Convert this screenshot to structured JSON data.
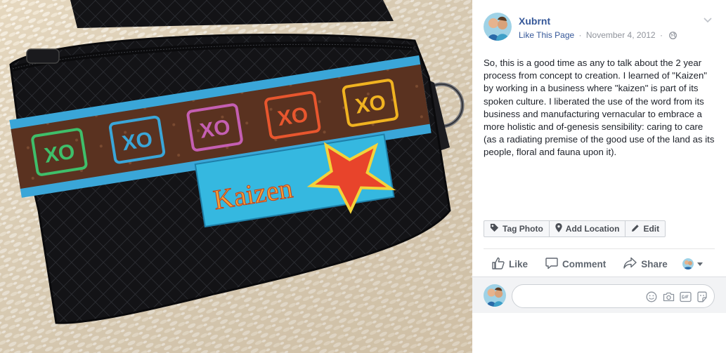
{
  "photo": {
    "label_text": "Kaizen",
    "logo_text": "XO",
    "alt": "Black wallet with embroidered ribbon and Kaizen label on rice"
  },
  "post": {
    "page_name": "Xubrnt",
    "like_page_label": "Like This Page",
    "separator": "·",
    "date": "November 4, 2012",
    "text": "So, this is a good time as any to talk about the 2 year process from concept to creation. I learned of \"Kaizen\" by working in a business where \"kaizen\" is part of its spoken culture. I liberated the use of the word from its business and manufacturing vernacular to embrace a more holistic and of-genesis sensibility: caring to care (as a radiating premise of the good use of the land as its people, floral and fauna upon it)."
  },
  "photo_actions": {
    "tag_photo": "Tag Photo",
    "add_location": "Add Location",
    "edit": "Edit"
  },
  "ufi": {
    "like": "Like",
    "comment": "Comment",
    "share": "Share"
  },
  "comment_box": {
    "placeholder": ""
  },
  "icons": {
    "globe": "globe-icon",
    "chevron": "chevron-down-icon",
    "tag": "tag-icon",
    "location": "location-pin-icon",
    "pencil": "pencil-icon",
    "like": "thumbs-up-icon",
    "comment": "comment-bubble-icon",
    "share": "share-arrow-icon",
    "emoji": "emoji-icon",
    "camera": "camera-icon",
    "gif": "gif-icon",
    "sticker": "sticker-icon"
  },
  "colors": {
    "link": "#365899",
    "secondary": "#90949c",
    "ribbon": "#3aa6d8",
    "wallet": "#151517"
  }
}
